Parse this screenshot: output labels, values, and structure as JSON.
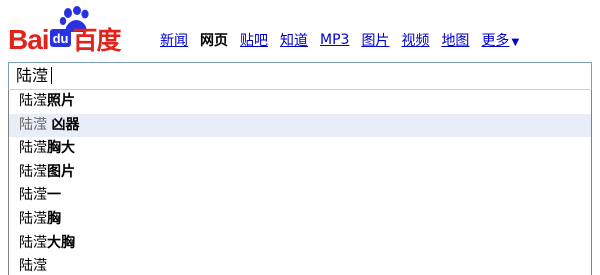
{
  "logo": {
    "bai": "Bai",
    "du": "du",
    "cn": "百度",
    "brand_red": "#e2231a",
    "brand_blue": "#2932e1"
  },
  "nav": {
    "items": [
      {
        "label": "新闻",
        "active": false
      },
      {
        "label": "网页",
        "active": true
      },
      {
        "label": "贴吧",
        "active": false
      },
      {
        "label": "知道",
        "active": false
      },
      {
        "label": "MP3",
        "active": false
      },
      {
        "label": "图片",
        "active": false
      },
      {
        "label": "视频",
        "active": false
      },
      {
        "label": "地图",
        "active": false
      }
    ],
    "more_label": "更多",
    "more_icon": "caret-down-icon",
    "link_color": "#0000cc"
  },
  "search": {
    "value": "陆滢"
  },
  "suggestions": [
    {
      "query": "陆滢",
      "rest": "照片",
      "highlight": false
    },
    {
      "query": "陆滢 ",
      "rest": "凶器",
      "highlight": true
    },
    {
      "query": "陆滢",
      "rest": "胸大",
      "highlight": false
    },
    {
      "query": "陆滢",
      "rest": "图片",
      "highlight": false
    },
    {
      "query": "陆滢",
      "rest": "一",
      "highlight": false
    },
    {
      "query": "陆滢",
      "rest": "胸",
      "highlight": false
    },
    {
      "query": "陆滢",
      "rest": "大胸",
      "highlight": false
    },
    {
      "query": "陆滢",
      "rest": "",
      "highlight": false
    }
  ]
}
